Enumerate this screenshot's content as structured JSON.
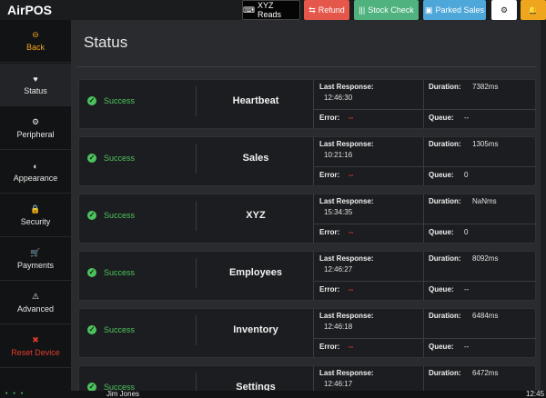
{
  "app_title": "AirPOS",
  "toolbar": {
    "xyz_reads": {
      "label": "XYZ Reads",
      "icon": "keyboard-icon",
      "color": "#050505"
    },
    "refund": {
      "label": "Refund",
      "icon": "refund-icon",
      "color": "#e4574a"
    },
    "stock_check": {
      "label": "Stock Check",
      "icon": "barcode-icon",
      "color": "#4fb27f"
    },
    "parked_sales": {
      "label": "Parked Sales",
      "icon": "parking-icon",
      "color": "#4da7d9"
    },
    "settings_icon": "gear-icon",
    "alert_icon": "bell-icon",
    "alert_color": "#f0a51f"
  },
  "sidebar": {
    "back": {
      "label": "Back",
      "icon": "back-circle-icon",
      "color": "#f0a51f"
    },
    "items": [
      {
        "label": "Status",
        "icon": "heartbeat-icon"
      },
      {
        "label": "Peripheral",
        "icon": "gear-icon"
      },
      {
        "label": "Appearance",
        "icon": "contrast-icon"
      },
      {
        "label": "Security",
        "icon": "lock-icon"
      },
      {
        "label": "Payments",
        "icon": "cart-icon"
      },
      {
        "label": "Advanced",
        "icon": "warning-icon"
      }
    ],
    "reset": {
      "label": "Reset Device",
      "icon": "x-icon",
      "color": "#e23b2e"
    }
  },
  "main": {
    "title": "Status",
    "labels": {
      "status": "Success",
      "last_response": "Last Response:",
      "duration": "Duration:",
      "error": "Error:",
      "queue": "Queue:"
    },
    "cards": [
      {
        "name": "Heartbeat",
        "last_response": "12:46:30",
        "duration": "7382ms",
        "error": "--",
        "queue": "--"
      },
      {
        "name": "Sales",
        "last_response": "10:21:16",
        "duration": "1305ms",
        "error": "--",
        "queue": "0"
      },
      {
        "name": "XYZ",
        "last_response": "15:34:35",
        "duration": "NaNms",
        "error": "--",
        "queue": "0"
      },
      {
        "name": "Employees",
        "last_response": "12:46:27",
        "duration": "8092ms",
        "error": "--",
        "queue": "--"
      },
      {
        "name": "Inventory",
        "last_response": "12:46:18",
        "duration": "6484ms",
        "error": "--",
        "queue": "--"
      },
      {
        "name": "Settings",
        "last_response": "12:46:17",
        "duration": "6472ms",
        "error": "--",
        "queue": "--"
      }
    ]
  },
  "statusbar": {
    "dots": "• • •",
    "user": "Jim Jones",
    "time": "12:45"
  }
}
